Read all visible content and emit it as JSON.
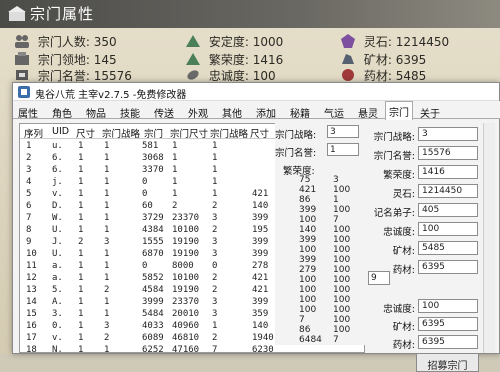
{
  "game": {
    "title": "宗门属性",
    "stats": [
      {
        "label": "宗门人数:",
        "value": "350",
        "icon": "people-icon",
        "color": "#6a6a6a"
      },
      {
        "label": "安定度:",
        "value": "1000",
        "icon": "triangle-icon",
        "color": "#4b7f5a"
      },
      {
        "label": "灵石:",
        "value": "1214450",
        "icon": "spirit-stone-icon",
        "color": "#7e4fa0"
      },
      {
        "label": "宗门领地:",
        "value": "145",
        "icon": "territory-icon",
        "color": "#5a5a5a"
      },
      {
        "label": "繁荣度:",
        "value": "1416",
        "icon": "triangle-icon",
        "color": "#4b7f5a"
      },
      {
        "label": "矿材:",
        "value": "6395",
        "icon": "ore-icon",
        "color": "#556070"
      },
      {
        "label": "宗门名誉:",
        "value": "15576",
        "icon": "reputation-icon",
        "color": "#5a5a5a"
      },
      {
        "label": "忠诚度:",
        "value": "100",
        "icon": "leaf-icon",
        "color": "#6a6a6a"
      },
      {
        "label": "药材:",
        "value": "5485",
        "icon": "herb-icon",
        "color": "#a03a3a"
      }
    ]
  },
  "window": {
    "title": "鬼谷八荒 主宰v2.7.5 -免费修改器",
    "tabs": [
      "属性",
      "角色",
      "物品",
      "技能",
      "传送",
      "外观",
      "其他",
      "添加",
      "秘籍",
      "气运",
      "悬灵",
      "宗门",
      "关于"
    ],
    "active_tab": "宗门"
  },
  "table": {
    "headers": [
      "序列",
      "UID",
      "尺寸",
      "宗门战略",
      "宗门",
      "宗门尺寸",
      "宗门战略",
      "尺寸"
    ],
    "rows": [
      [
        "1",
        "u.",
        "1",
        "1",
        "581",
        "1",
        "1",
        ""
      ],
      [
        "2",
        "6.",
        "1",
        "1",
        "3068",
        "1",
        "1",
        ""
      ],
      [
        "3",
        "6.",
        "1",
        "1",
        "3370",
        "1",
        "1",
        ""
      ],
      [
        "4",
        "j.",
        "1",
        "1",
        "0",
        "1",
        "1",
        ""
      ],
      [
        "5",
        "v.",
        "1",
        "1",
        "0",
        "1",
        "1",
        "421"
      ],
      [
        "6",
        "D.",
        "1",
        "1",
        "60",
        "2",
        "2",
        "140"
      ],
      [
        "7",
        "W.",
        "1",
        "1",
        "3729",
        "23370",
        "3",
        "399"
      ],
      [
        "8",
        "U.",
        "1",
        "1",
        "4384",
        "10100",
        "2",
        "195"
      ],
      [
        "9",
        "J.",
        "2",
        "3",
        "1555",
        "19190",
        "3",
        "399"
      ],
      [
        "10",
        "U.",
        "1",
        "1",
        "6870",
        "19190",
        "3",
        "399"
      ],
      [
        "11",
        "a.",
        "1",
        "1",
        "0",
        "8000",
        "0",
        "278"
      ],
      [
        "12",
        "a.",
        "1",
        "1",
        "5852",
        "10100",
        "2",
        "421"
      ],
      [
        "13",
        "5.",
        "1",
        "2",
        "4584",
        "19190",
        "2",
        "421"
      ],
      [
        "14",
        "A.",
        "1",
        "1",
        "3999",
        "23370",
        "3",
        "399"
      ],
      [
        "15",
        "3.",
        "1",
        "1",
        "5484",
        "20010",
        "3",
        "359"
      ],
      [
        "16",
        "0.",
        "1",
        "3",
        "4033",
        "40960",
        "1",
        "140"
      ],
      [
        "17",
        "v.",
        "1",
        "2",
        "6089",
        "46810",
        "2",
        "1940"
      ],
      [
        "18",
        "N.",
        "1",
        "1",
        "6252",
        "47160",
        "7",
        "6230"
      ]
    ]
  },
  "mid_panel": {
    "strategy_label": "宗门战略:",
    "strategy_value": "3",
    "name_label": "宗门名誉:",
    "name_value": "1",
    "prosperity_label": "繁荣度:",
    "col_values": [
      [
        "75",
        "3"
      ],
      [
        "421",
        "100"
      ],
      [
        "86",
        "1"
      ],
      [
        "399",
        "100"
      ],
      [
        "100",
        "7"
      ],
      [
        "140",
        "100"
      ],
      [
        "399",
        "100"
      ],
      [
        "100",
        "100"
      ],
      [
        "399",
        "100"
      ],
      [
        "279",
        "100"
      ],
      [
        "100",
        "100"
      ],
      [
        "100",
        "100"
      ],
      [
        "100",
        "100"
      ],
      [
        "100",
        "100"
      ],
      [
        "7",
        "100"
      ],
      [
        "86",
        "100"
      ],
      [
        "6484",
        "7"
      ]
    ]
  },
  "right_panel": {
    "fields": [
      {
        "label": "宗门战略:",
        "value": "3"
      },
      {
        "label": "宗门名誉:",
        "value": "15576"
      },
      {
        "label": "繁荣度:",
        "value": "1416"
      },
      {
        "label": "灵石:",
        "value": "1214450"
      },
      {
        "label": "记名弟子:",
        "value": "405"
      },
      {
        "label": "忠诚度:",
        "value": "100"
      },
      {
        "label": "矿材:",
        "value": "5485"
      },
      {
        "label": "药材:",
        "value": "6395"
      }
    ],
    "small_input_value": "9",
    "recruit_button": "招募宗门",
    "bottom_fields": [
      {
        "label": "忠诚度:",
        "value": "100"
      },
      {
        "label": "矿材:",
        "value": "6395"
      },
      {
        "label": "药材:",
        "value": "6395"
      }
    ]
  }
}
